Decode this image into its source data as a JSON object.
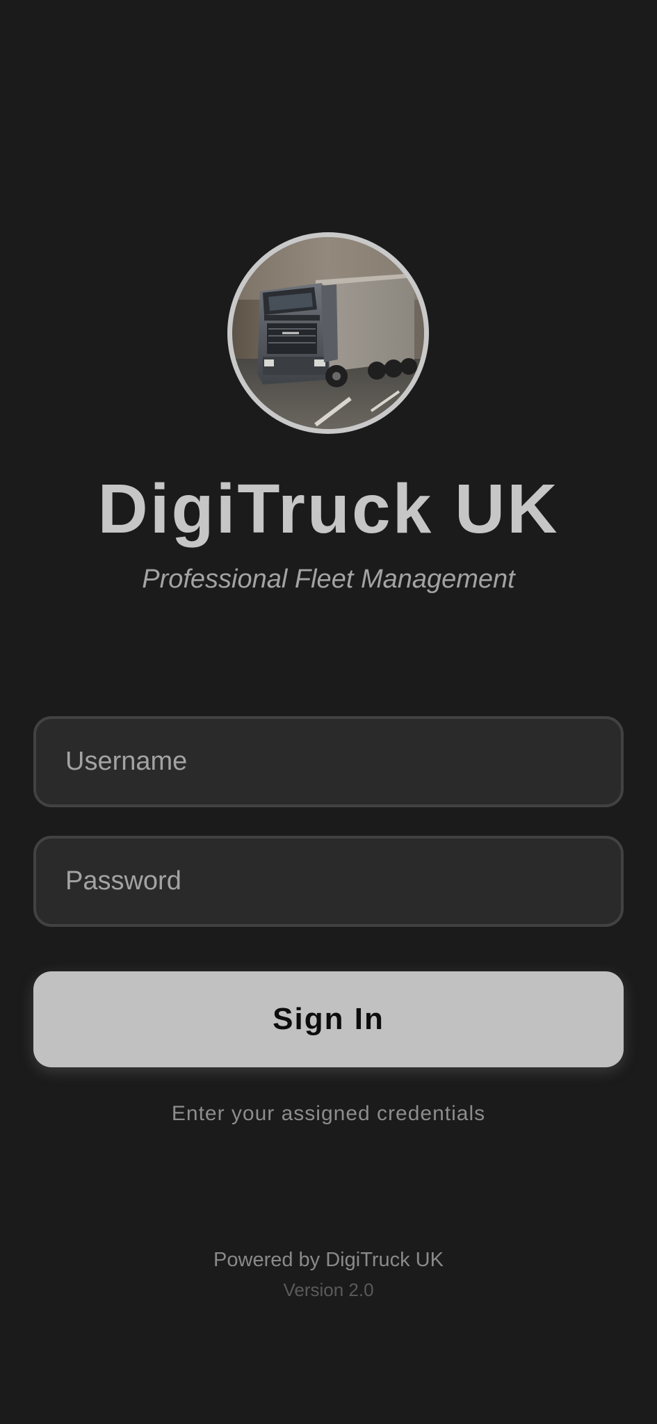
{
  "app": {
    "title": "DigiTruck UK",
    "subtitle": "Professional Fleet Management",
    "logo_icon": "truck-photo-icon"
  },
  "form": {
    "username_placeholder": "Username",
    "username_value": "",
    "password_placeholder": "Password",
    "password_value": "",
    "signin_label": "Sign In",
    "hint": "Enter your assigned credentials"
  },
  "footer": {
    "powered_by": "Powered by DigiTruck UK",
    "version": "Version 2.0"
  },
  "colors": {
    "background": "#1b1b1b",
    "field_background": "#2a2a2a",
    "field_border": "#424242",
    "button_background": "#c1c1c1",
    "title_text": "#c6c6c6"
  }
}
